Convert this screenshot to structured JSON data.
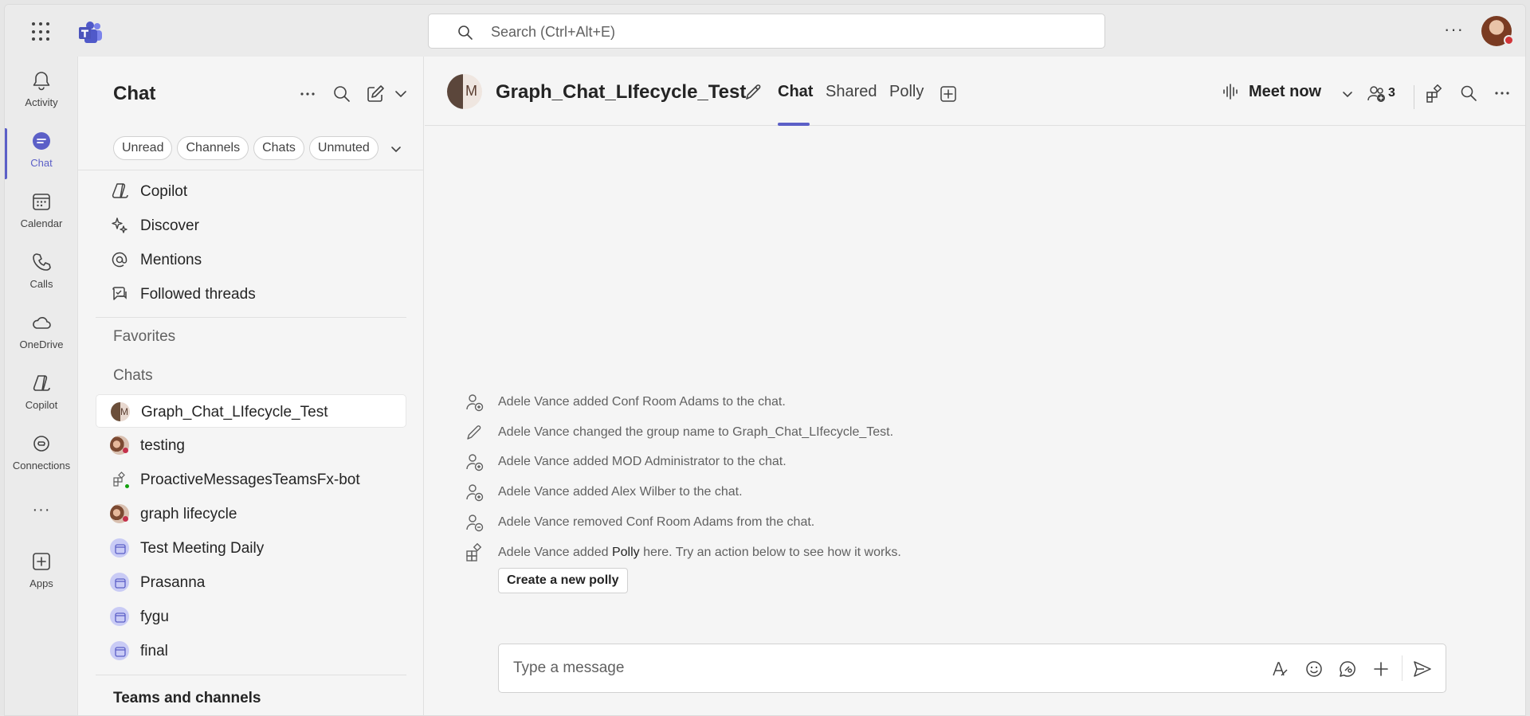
{
  "topbar": {
    "search_placeholder": "Search (Ctrl+Alt+E)"
  },
  "rail": {
    "items": [
      {
        "label": "Activity",
        "icon": "bell-icon"
      },
      {
        "label": "Chat",
        "icon": "chat-icon"
      },
      {
        "label": "Calendar",
        "icon": "calendar-icon"
      },
      {
        "label": "Calls",
        "icon": "phone-icon"
      },
      {
        "label": "OneDrive",
        "icon": "cloud-icon"
      },
      {
        "label": "Copilot",
        "icon": "copilot-icon"
      },
      {
        "label": "Connections",
        "icon": "connections-icon"
      },
      {
        "label": "Apps",
        "icon": "add-app-icon"
      }
    ]
  },
  "chat_list": {
    "title": "Chat",
    "filters": [
      "Unread",
      "Channels",
      "Chats",
      "Unmuted"
    ],
    "pinned": [
      {
        "label": "Copilot",
        "icon": "copilot-icon"
      },
      {
        "label": "Discover",
        "icon": "sparkle-icon"
      },
      {
        "label": "Mentions",
        "icon": "at-icon"
      },
      {
        "label": "Followed threads",
        "icon": "threads-icon"
      }
    ],
    "favorites_label": "Favorites",
    "chats_label": "Chats",
    "chats": [
      {
        "label": "Graph_Chat_LIfecycle_Test",
        "selected": true
      },
      {
        "label": "testing"
      },
      {
        "label": "ProactiveMessagesTeamsFx-bot"
      },
      {
        "label": "graph lifecycle"
      },
      {
        "label": "Test Meeting Daily"
      },
      {
        "label": "Prasanna"
      },
      {
        "label": "fygu"
      },
      {
        "label": "final"
      }
    ],
    "teams_label": "Teams and channels"
  },
  "header": {
    "avatar_initial": "M",
    "title": "Graph_Chat_LIfecycle_Test",
    "tabs": [
      "Chat",
      "Shared",
      "Polly"
    ],
    "meet_now": "Meet now",
    "participants_count": "3"
  },
  "events": [
    {
      "text": "Adele Vance added Conf Room Adams to the chat.",
      "icon": "person-add-icon"
    },
    {
      "text": "Adele Vance changed the group name to Graph_Chat_LIfecycle_Test.",
      "icon": "pencil-icon"
    },
    {
      "text": "Adele Vance added MOD Administrator to the chat.",
      "icon": "person-add-icon"
    },
    {
      "text": "Adele Vance added Alex Wilber to the chat.",
      "icon": "person-add-icon"
    },
    {
      "text": "Adele Vance removed Conf Room Adams from the chat.",
      "icon": "person-remove-icon"
    },
    {
      "text_before": "Adele Vance added ",
      "highlight": "Polly",
      "text_after": " here. Try an action below to see how it works.",
      "icon": "apps-icon"
    }
  ],
  "polly_button": "Create a new polly",
  "composer": {
    "placeholder": "Type a message"
  },
  "colors": {
    "accent": "#5b5fc7",
    "presence_busy": "#d13438",
    "presence_available": "#13a10e"
  }
}
